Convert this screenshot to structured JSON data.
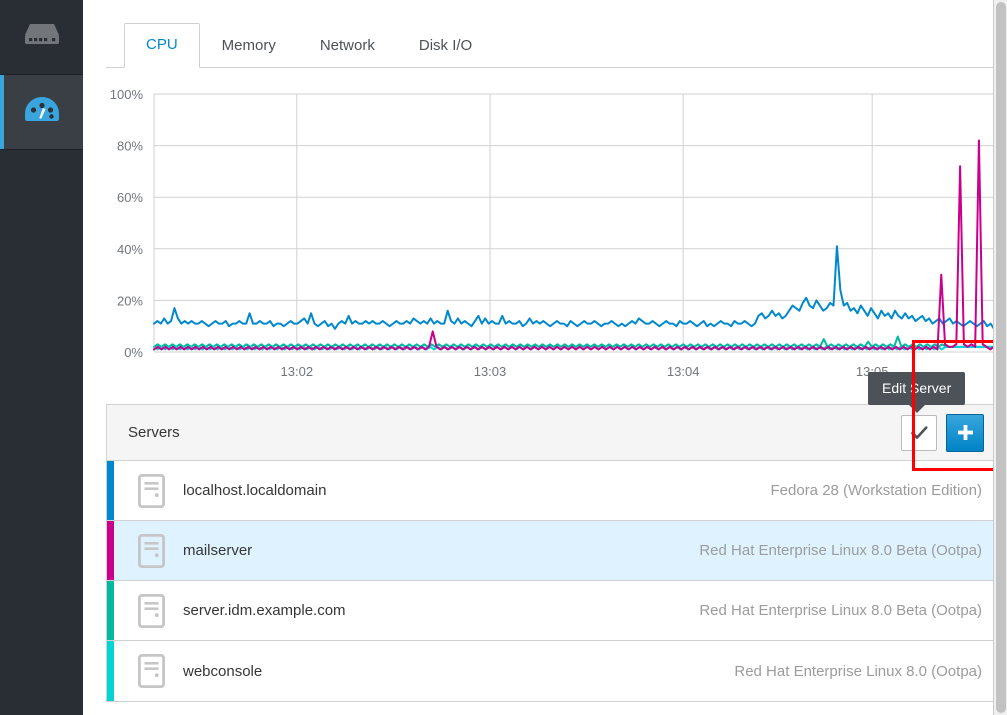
{
  "sidebar": {
    "items": [
      {
        "name": "server-icon",
        "label": "Servers",
        "active": false
      },
      {
        "name": "dashboard-icon",
        "label": "Dashboard",
        "active": true
      }
    ]
  },
  "tabs": [
    {
      "label": "CPU",
      "active": true
    },
    {
      "label": "Memory",
      "active": false
    },
    {
      "label": "Network",
      "active": false
    },
    {
      "label": "Disk I/O",
      "active": false
    }
  ],
  "tooltip": {
    "text": "Edit Server"
  },
  "servers_panel": {
    "title": "Servers",
    "check_button_label": "✔",
    "add_button_label": "+",
    "rows": [
      {
        "name": "localhost.localdomain",
        "os": "Fedora 28 (Workstation Edition)",
        "color": "#0088ce",
        "selected": false
      },
      {
        "name": "mailserver",
        "os": "Red Hat Enterprise Linux 8.0 Beta (Ootpa)",
        "color": "#c9008d",
        "selected": true
      },
      {
        "name": "server.idm.example.com",
        "os": "Red Hat Enterprise Linux 8.0 Beta (Ootpa)",
        "color": "#00b9a0",
        "selected": false
      },
      {
        "name": "webconsole",
        "os": "Red Hat Enterprise Linux 8.0 (Ootpa)",
        "color": "#00d5d5",
        "selected": false
      }
    ]
  },
  "colors": {
    "accent": "#0088ce",
    "sidebar_bg": "#292e34",
    "sidebar_active_bg": "#393f44",
    "annotation": "#ff0000",
    "tooltip_bg": "#4d5258",
    "grid": "#d1d1d1"
  },
  "chart_data": {
    "type": "line",
    "title": "CPU",
    "xlabel": "",
    "ylabel": "",
    "ylim": [
      0,
      100
    ],
    "ytick_labels": [
      "0%",
      "20%",
      "40%",
      "60%",
      "80%",
      "100%"
    ],
    "ytick_values": [
      0,
      20,
      40,
      60,
      80,
      100
    ],
    "xtick_labels": [
      "13:02",
      "13:03",
      "13:04",
      "13:05"
    ],
    "xtick_positions": [
      0.17,
      0.4,
      0.63,
      0.855
    ],
    "grid": true,
    "legend": "none",
    "series": [
      {
        "name": "localhost.localdomain",
        "color": "#0088ce",
        "values": [
          11,
          12,
          11,
          13,
          11,
          12,
          17,
          13,
          11,
          12,
          11,
          12,
          11,
          11,
          12,
          11,
          10,
          11,
          12,
          11,
          11,
          12,
          10,
          11,
          11,
          12,
          11,
          11,
          15,
          11,
          11,
          12,
          11,
          11,
          12,
          10,
          11,
          11,
          10,
          11,
          12,
          11,
          11,
          12,
          13,
          11,
          15,
          11,
          10,
          11,
          12,
          10,
          11,
          9,
          11,
          12,
          11,
          14,
          11,
          12,
          11,
          11,
          12,
          11,
          12,
          11,
          11,
          12,
          11,
          10,
          11,
          12,
          11,
          11,
          12,
          11,
          13,
          12,
          11,
          12,
          11,
          13,
          11,
          12,
          11,
          11,
          16,
          12,
          11,
          13,
          11,
          12,
          11,
          10,
          12,
          14,
          11,
          13,
          11,
          12,
          11,
          11,
          14,
          11,
          12,
          11,
          11,
          12,
          10,
          11,
          13,
          11,
          12,
          11,
          12,
          11,
          10,
          11,
          12,
          11,
          11,
          10,
          12,
          11,
          10,
          11,
          12,
          11,
          11,
          12,
          11,
          10,
          11,
          11,
          12,
          11,
          10,
          11,
          10,
          11,
          12,
          11,
          13,
          12,
          11,
          11,
          12,
          11,
          10,
          11,
          12,
          11,
          11,
          10,
          12,
          11,
          11,
          12,
          11,
          10,
          11,
          12,
          10,
          11,
          10,
          11,
          12,
          11,
          11,
          10,
          12,
          11,
          11,
          12,
          11,
          10,
          11,
          14,
          15,
          13,
          14,
          16,
          14,
          15,
          13,
          14,
          16,
          18,
          17,
          16,
          19,
          21,
          18,
          17,
          20,
          18,
          16,
          17,
          19,
          18,
          41,
          24,
          18,
          19,
          16,
          17,
          15,
          18,
          16,
          14,
          17,
          15,
          13,
          16,
          14,
          15,
          13,
          16,
          14,
          13,
          15,
          13,
          14,
          12,
          13,
          14,
          12,
          13,
          11,
          12,
          13,
          11,
          12,
          13,
          11,
          12,
          11,
          10,
          11,
          12,
          11,
          10,
          11,
          12,
          10,
          11,
          9
        ]
      },
      {
        "name": "mailserver",
        "color": "#c9008d",
        "values": [
          1,
          2,
          1,
          2,
          1,
          2,
          1,
          2,
          1,
          2,
          1,
          2,
          1,
          2,
          1,
          2,
          1,
          2,
          1,
          2,
          1,
          2,
          1,
          2,
          1,
          2,
          1,
          2,
          1,
          2,
          1,
          2,
          1,
          2,
          1,
          2,
          1,
          2,
          1,
          2,
          1,
          2,
          1,
          2,
          1,
          2,
          1,
          2,
          1,
          2,
          1,
          2,
          1,
          2,
          1,
          2,
          1,
          2,
          1,
          2,
          1,
          2,
          1,
          2,
          1,
          2,
          1,
          2,
          1,
          2,
          1,
          2,
          1,
          2,
          8,
          2,
          1,
          2,
          1,
          2,
          1,
          2,
          1,
          2,
          1,
          2,
          1,
          2,
          1,
          2,
          1,
          2,
          1,
          2,
          1,
          2,
          1,
          2,
          1,
          2,
          1,
          2,
          1,
          2,
          1,
          2,
          1,
          2,
          1,
          2,
          1,
          2,
          1,
          2,
          1,
          2,
          1,
          2,
          1,
          2,
          1,
          2,
          1,
          2,
          1,
          2,
          1,
          2,
          1,
          2,
          1,
          2,
          1,
          2,
          1,
          2,
          1,
          2,
          1,
          2,
          1,
          2,
          1,
          2,
          1,
          2,
          1,
          2,
          1,
          2,
          1,
          2,
          1,
          2,
          1,
          2,
          1,
          2,
          1,
          2,
          1,
          2,
          1,
          2,
          1,
          2,
          1,
          2,
          1,
          2,
          1,
          2,
          1,
          2,
          1,
          2,
          1,
          2,
          1,
          2,
          1,
          2,
          1,
          2,
          1,
          2,
          1,
          2,
          1,
          2,
          1,
          2,
          1,
          2,
          1,
          2,
          1,
          2,
          1,
          2,
          1,
          2,
          1,
          2,
          1,
          2,
          1,
          2,
          1,
          30,
          3,
          2,
          2,
          3,
          72,
          3,
          2,
          3,
          2,
          82,
          3,
          2,
          1,
          2
        ]
      },
      {
        "name": "server.idm.example.com",
        "color": "#00b9a0",
        "values": [
          2,
          3,
          2,
          3,
          2,
          3,
          2,
          3,
          2,
          3,
          2,
          3,
          2,
          3,
          2,
          3,
          2,
          3,
          2,
          3,
          2,
          3,
          2,
          3,
          2,
          3,
          2,
          3,
          2,
          3,
          2,
          3,
          2,
          3,
          2,
          3,
          2,
          3,
          2,
          3,
          2,
          3,
          2,
          3,
          2,
          3,
          2,
          3,
          2,
          3,
          2,
          3,
          2,
          3,
          2,
          3,
          2,
          3,
          2,
          3,
          2,
          3,
          2,
          3,
          2,
          3,
          2,
          3,
          2,
          3,
          2,
          3,
          2,
          3,
          2,
          3,
          2,
          3,
          2,
          3,
          2,
          3,
          2,
          3,
          2,
          3,
          2,
          3,
          2,
          3,
          2,
          3,
          2,
          3,
          2,
          3,
          2,
          3,
          2,
          3,
          2,
          3,
          2,
          3,
          2,
          3,
          2,
          3,
          2,
          3,
          2,
          3,
          2,
          3,
          2,
          3,
          2,
          3,
          2,
          3,
          2,
          3,
          2,
          3,
          2,
          3,
          2,
          3,
          2,
          3,
          2,
          3,
          2,
          3,
          2,
          3,
          2,
          3,
          2,
          3,
          2,
          3,
          2,
          3,
          2,
          3,
          2,
          3,
          2,
          3,
          2,
          3,
          2,
          3,
          2,
          3,
          2,
          3,
          2,
          3,
          2,
          3,
          2,
          3,
          2,
          3,
          2,
          3,
          2,
          3,
          2,
          3,
          2,
          3,
          2,
          3,
          2,
          3,
          2,
          3,
          2,
          5,
          2,
          3,
          2,
          3,
          2,
          3,
          2,
          3,
          2,
          3,
          2,
          4,
          2,
          3,
          2,
          3,
          2,
          3,
          2,
          6,
          2,
          3,
          2,
          3,
          2,
          3,
          2,
          3,
          2,
          3,
          2,
          3,
          2,
          2,
          2,
          2,
          2,
          2,
          2,
          2,
          2,
          2,
          2,
          2,
          2,
          2
        ]
      },
      {
        "name": "webconsole",
        "color": "#00d5d5",
        "values": [
          2,
          1,
          2,
          1,
          2,
          1,
          2,
          1,
          2,
          1,
          2,
          1,
          2,
          1,
          2,
          1,
          2,
          1,
          2,
          1,
          2,
          1,
          2,
          1,
          2,
          1,
          2,
          1,
          2,
          1,
          2,
          1,
          2,
          1,
          2,
          1,
          2,
          1,
          2,
          1,
          2,
          1,
          2,
          1,
          2,
          1,
          2,
          1,
          2,
          1,
          2,
          1,
          2,
          1,
          2,
          1,
          2,
          1,
          2,
          1,
          2,
          1,
          2,
          1,
          2,
          1,
          2,
          1,
          2,
          1,
          2,
          1,
          2,
          1,
          2,
          1,
          2,
          1,
          2,
          1,
          2,
          1,
          2,
          1,
          2,
          1,
          2,
          1,
          2,
          1,
          2,
          1,
          2,
          1,
          2,
          1,
          2,
          1,
          2,
          1,
          2,
          1,
          2,
          1,
          2,
          1,
          2,
          1,
          2,
          1,
          2,
          1,
          2,
          1,
          2,
          1,
          2,
          1,
          2,
          1,
          2,
          1,
          2,
          1,
          2,
          1,
          2,
          1,
          2,
          1,
          2,
          1,
          2,
          1,
          2,
          1,
          2,
          1,
          2,
          1,
          2,
          1,
          2,
          1,
          2,
          1,
          2,
          1,
          2,
          1,
          2,
          1,
          2,
          1,
          2,
          1,
          2,
          1,
          2,
          1,
          2,
          1,
          2,
          1,
          2,
          1,
          2,
          1,
          2,
          1,
          2,
          1,
          2,
          1,
          2,
          1,
          2,
          1,
          2,
          1,
          2,
          1,
          2,
          1,
          2,
          1,
          2,
          1,
          2,
          1,
          2,
          1,
          2,
          1,
          2,
          1,
          2,
          1,
          2,
          1,
          2,
          1,
          2,
          1,
          2,
          1,
          2,
          1,
          2,
          1,
          2,
          1,
          2,
          2,
          2,
          2,
          2,
          2,
          2,
          2,
          2,
          2,
          2,
          2,
          2,
          2
        ]
      }
    ]
  }
}
